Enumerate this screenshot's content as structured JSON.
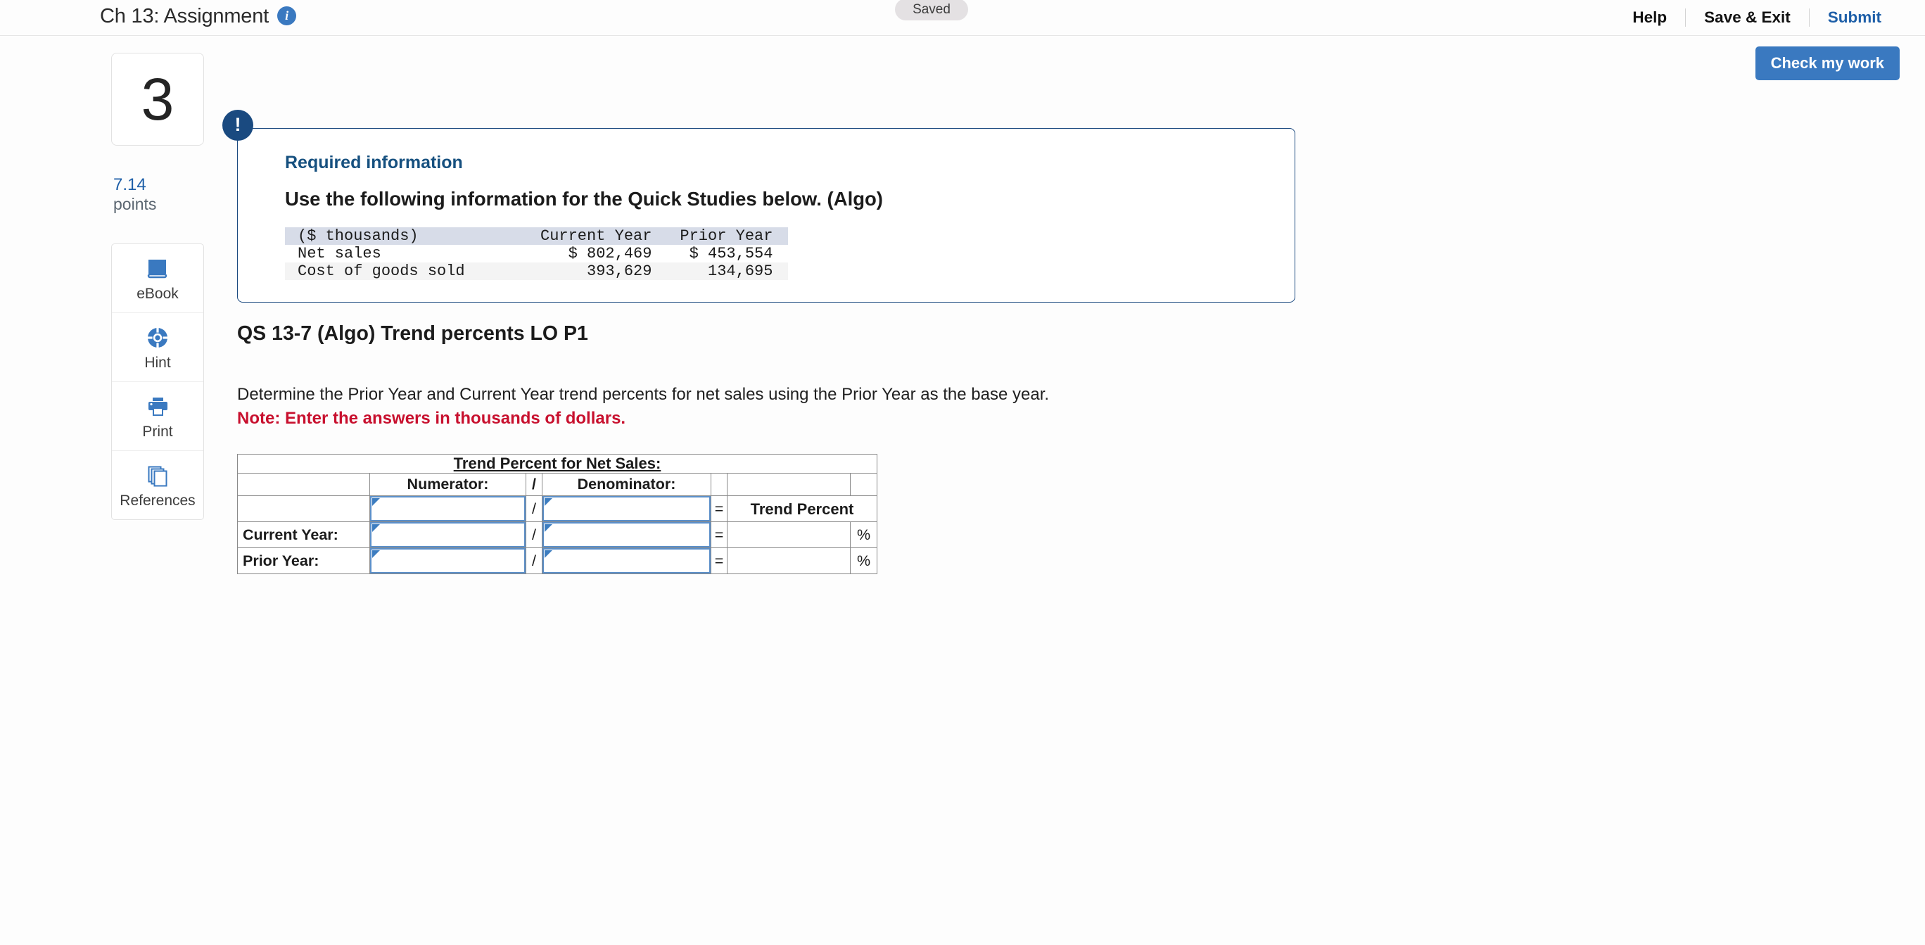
{
  "header": {
    "title": "Ch 13: Assignment",
    "info_icon": "info-icon",
    "status_pill": "Saved",
    "nav": [
      {
        "label": "Help",
        "accent": false
      },
      {
        "label": "Save & Exit",
        "accent": false
      },
      {
        "label": "Submit",
        "accent": true
      }
    ]
  },
  "actions": {
    "check_my_work": "Check my work"
  },
  "sidebar": {
    "question_number": "3",
    "points_value": "7.14",
    "points_label": "points",
    "tools": [
      {
        "label": "eBook",
        "icon": "ebook-icon"
      },
      {
        "label": "Hint",
        "icon": "lifebuoy-icon"
      },
      {
        "label": "Print",
        "icon": "printer-icon"
      },
      {
        "label": "References",
        "icon": "copy-pages-icon"
      }
    ]
  },
  "callout": {
    "badge": "!",
    "title": "Required information",
    "subtitle": "Use the following information for the Quick Studies below. (Algo)",
    "table": {
      "headers": [
        "($ thousands)",
        "Current Year",
        "Prior Year"
      ],
      "rows": [
        {
          "label": "Net sales",
          "current": "$ 802,469",
          "prior": "$ 453,554"
        },
        {
          "label": "Cost of goods sold",
          "current": "393,629",
          "prior": "134,695"
        }
      ]
    }
  },
  "question": {
    "title": "QS 13-7 (Algo) Trend percents LO P1",
    "prompt": "Determine the Prior Year and Current Year trend percents for net sales using the Prior Year as the base year.",
    "note": "Note: Enter the answers in thousands of dollars."
  },
  "answer_table": {
    "band_title": "Trend Percent for Net Sales:",
    "col_numerator": "Numerator:",
    "col_slash": "/",
    "col_denominator": "Denominator:",
    "col_equals": "=",
    "trend_percent_label": "Trend Percent",
    "percent_symbol": "%",
    "rows": [
      {
        "label": "",
        "numerator": "",
        "denominator": "",
        "result": ""
      },
      {
        "label": "Current Year:",
        "numerator": "",
        "denominator": "",
        "result": ""
      },
      {
        "label": "Prior Year:",
        "numerator": "",
        "denominator": "",
        "result": ""
      }
    ]
  },
  "colors": {
    "accent_blue": "#3a79c0",
    "link_blue": "#1e5fa8",
    "table_header_blue": "#7cabe0",
    "note_red": "#c8102e",
    "callout_navy": "#1a4a80"
  }
}
